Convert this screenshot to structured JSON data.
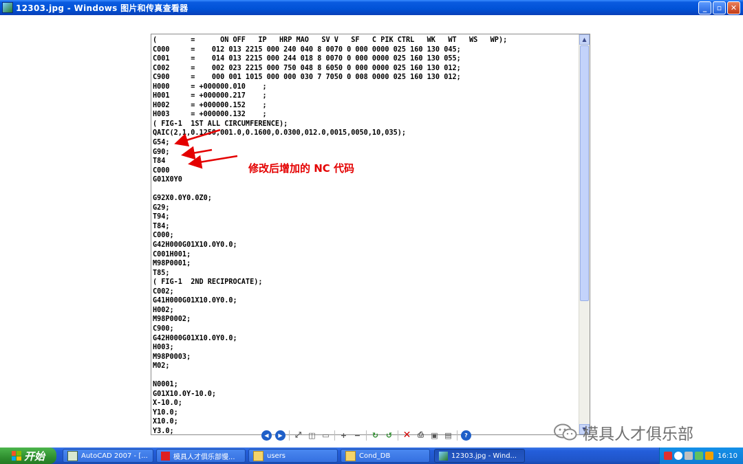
{
  "window": {
    "title": "12303.jpg - Windows 图片和传真查看器",
    "minimize": "_",
    "restore": "▫",
    "close": "✕"
  },
  "code_lines": [
    "(        =      ON OFF   IP   HRP MAO   SV V   SF   C PIK CTRL   WK   WT   WS   WP);",
    "C000     =    012 013 2215 000 240 040 8 0070 0 000 0000 025 160 130 045;",
    "C001     =    014 013 2215 000 244 018 8 0070 0 000 0000 025 160 130 055;",
    "C002     =    002 023 2215 000 750 048 8 6050 0 000 0000 025 160 130 012;",
    "C900     =    000 001 1015 000 000 030 7 7050 0 008 0000 025 160 130 012;",
    "H000     = +000000.010    ;",
    "H001     = +000000.217    ;",
    "H002     = +000000.152    ;",
    "H003     = +000000.132    ;",
    "( FIG-1  1ST ALL CIRCUMFERENCE);",
    "QAIC(2,1,0.1250,001.0,0.1600,0.0300,012.0,0015,0050,10,035);",
    "G54;",
    "G90;",
    "T84",
    "C000",
    "G01X0Y0",
    "",
    "G92X0.0Y0.0Z0;",
    "G29;",
    "T94;",
    "T84;",
    "C000;",
    "G42H000G01X10.0Y0.0;",
    "C001H001;",
    "M98P0001;",
    "T85;",
    "( FIG-1  2ND RECIPROCATE);",
    "C002;",
    "G41H000G01X10.0Y0.0;",
    "H002;",
    "M98P0002;",
    "C900;",
    "G42H000G01X10.0Y0.0;",
    "H003;",
    "M98P0003;",
    "M02;",
    "",
    "N0001;",
    "G01X10.0Y-10.0;",
    "X-10.0;",
    "Y10.0;",
    "X10.0;",
    "Y3.0;"
  ],
  "annotation": "修改后增加的 NC 代码",
  "annotation_color": "#e40000",
  "toolbar": {
    "prev": "◀",
    "next": "▶",
    "best_fit": "⤢",
    "actual_size": "◫",
    "slideshow": "▭",
    "zoom_in": "+",
    "zoom_out": "−",
    "rotate_cw": "↻",
    "rotate_ccw": "↺",
    "delete": "✕",
    "print": "⎙",
    "save": "▣",
    "open": "▤",
    "help": "?"
  },
  "watermark": "模具人才俱乐部",
  "taskbar": {
    "start_label": "开始",
    "tasks": [
      {
        "label": "AutoCAD 2007 - [..."
      },
      {
        "label": "模具人才俱乐部慢..."
      },
      {
        "label": "users"
      },
      {
        "label": "Cond_DB"
      },
      {
        "label": "12303.jpg - Wind..."
      }
    ],
    "clock": "16:10"
  }
}
